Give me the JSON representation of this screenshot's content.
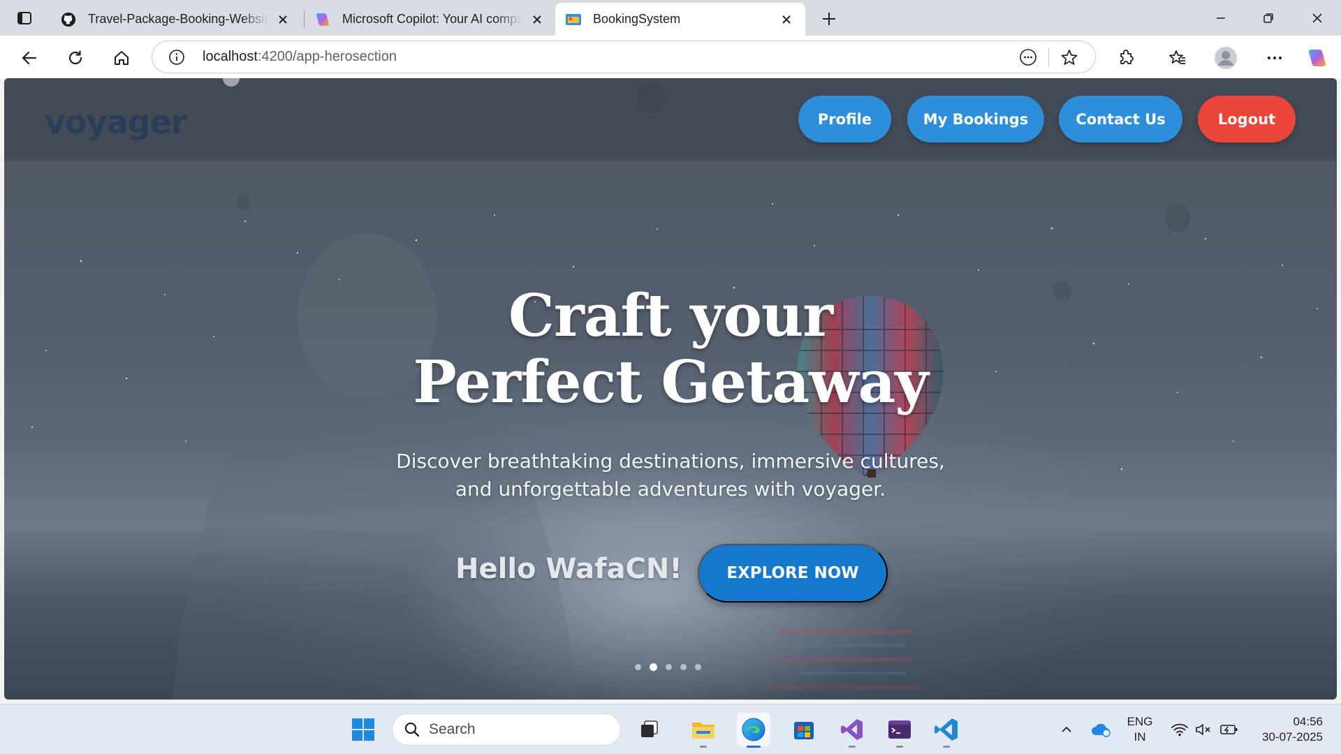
{
  "browser": {
    "tabs": [
      {
        "title": "Travel-Package-Booking-Website",
        "favicon": "github-icon",
        "active": false
      },
      {
        "title": "Microsoft Copilot: Your AI companion",
        "favicon": "copilot-icon",
        "active": false
      },
      {
        "title": "BookingSystem",
        "favicon": "angular-app-icon",
        "active": true
      }
    ],
    "address": {
      "host": "localhost",
      "path": ":4200/app-herosection"
    }
  },
  "site": {
    "brand": "voyager",
    "nav": [
      {
        "label": "Profile",
        "color": "#2d8fdc"
      },
      {
        "label": "My Bookings",
        "color": "#2d8fdc"
      },
      {
        "label": "Contact Us",
        "color": "#2d8fdc"
      },
      {
        "label": "Logout",
        "color": "#ea4538"
      }
    ],
    "hero": {
      "title_line1": "Craft your",
      "title_line2": "Perfect Getaway",
      "subtitle_line1": "Discover breathtaking destinations, immersive cultures,",
      "subtitle_line2": "and unforgettable adventures with voyager.",
      "greeting": "Hello WafaCN!",
      "cta": "EXPLORE NOW",
      "cta_color": "#1677cf",
      "carousel": {
        "slides": 5,
        "active": 2
      }
    }
  },
  "taskbar": {
    "search_placeholder": "Search",
    "apps": [
      "start-icon",
      "task-view-icon",
      "file-explorer-icon",
      "edge-icon",
      "microsoft-store-icon",
      "visual-studio-icon",
      "terminal-icon",
      "vscode-icon"
    ],
    "tray": {
      "lang_line1": "ENG",
      "lang_line2": "IN",
      "time": "04:56",
      "date": "30-07-2025"
    }
  }
}
